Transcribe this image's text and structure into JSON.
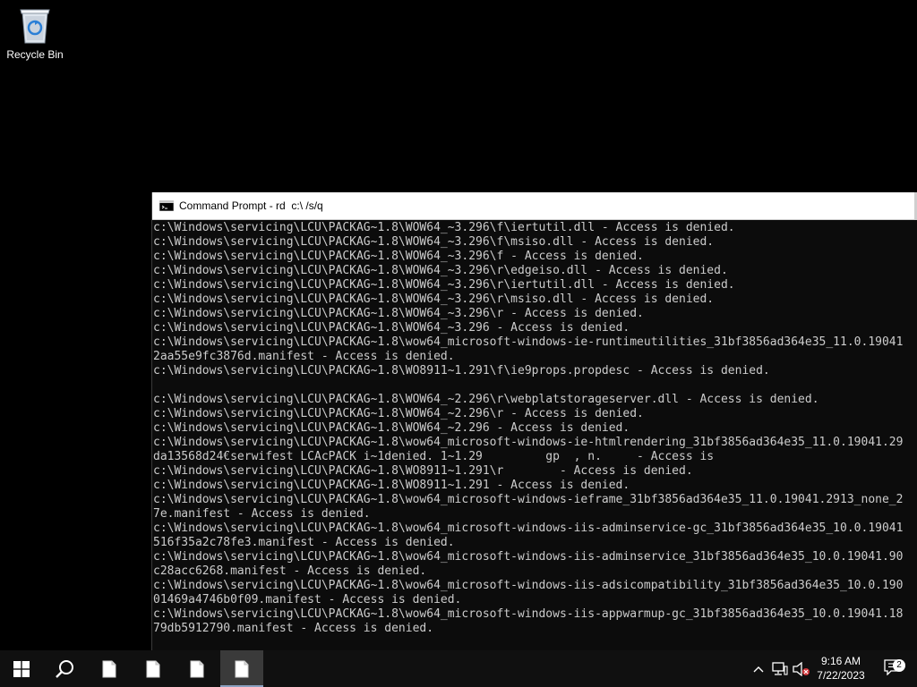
{
  "desktop": {
    "recycle_bin_label": "Recycle Bin"
  },
  "window": {
    "title": "Command Prompt - rd  c:\\ /s/q",
    "lines": [
      "c:\\Windows\\servicing\\LCU\\PACKAG~1.8\\WOW64_~3.296\\f\\iertutil.dll - Access is denied.",
      "c:\\Windows\\servicing\\LCU\\PACKAG~1.8\\WOW64_~3.296\\f\\msiso.dll - Access is denied.",
      "c:\\Windows\\servicing\\LCU\\PACKAG~1.8\\WOW64_~3.296\\f - Access is denied.",
      "c:\\Windows\\servicing\\LCU\\PACKAG~1.8\\WOW64_~3.296\\r\\edgeiso.dll - Access is denied.",
      "c:\\Windows\\servicing\\LCU\\PACKAG~1.8\\WOW64_~3.296\\r\\iertutil.dll - Access is denied.",
      "c:\\Windows\\servicing\\LCU\\PACKAG~1.8\\WOW64_~3.296\\r\\msiso.dll - Access is denied.",
      "c:\\Windows\\servicing\\LCU\\PACKAG~1.8\\WOW64_~3.296\\r - Access is denied.",
      "c:\\Windows\\servicing\\LCU\\PACKAG~1.8\\WOW64_~3.296 - Access is denied.",
      "c:\\Windows\\servicing\\LCU\\PACKAG~1.8\\wow64_microsoft-windows-ie-runtimeutilities_31bf3856ad364e35_11.0.19041",
      "2aa55e9fc3876d.manifest - Access is denied.",
      "c:\\Windows\\servicing\\LCU\\PACKAG~1.8\\WO8911~1.291\\f\\ie9props.propdesc - Access is denied.",
      "",
      "c:\\Windows\\servicing\\LCU\\PACKAG~1.8\\WOW64_~2.296\\r\\webplatstorageserver.dll - Access is denied.",
      "c:\\Windows\\servicing\\LCU\\PACKAG~1.8\\WOW64_~2.296\\r - Access is denied.",
      "c:\\Windows\\servicing\\LCU\\PACKAG~1.8\\WOW64_~2.296 - Access is denied.",
      "c:\\Windows\\servicing\\LCU\\PACKAG~1.8\\wow64_microsoft-windows-ie-htmlrendering_31bf3856ad364e35_11.0.19041.29",
      "da13568d24€serwifest LCAcPACK i~1denied. 1~1.29         gp  , n.     - Access is",
      "c:\\Windows\\servicing\\LCU\\PACKAG~1.8\\WO8911~1.291\\r        - Access is denied.",
      "c:\\Windows\\servicing\\LCU\\PACKAG~1.8\\WO8911~1.291 - Access is denied.",
      "c:\\Windows\\servicing\\LCU\\PACKAG~1.8\\wow64_microsoft-windows-ieframe_31bf3856ad364e35_11.0.19041.2913_none_2",
      "7e.manifest - Access is denied.",
      "c:\\Windows\\servicing\\LCU\\PACKAG~1.8\\wow64_microsoft-windows-iis-adminservice-gc_31bf3856ad364e35_10.0.19041",
      "516f35a2c78fe3.manifest - Access is denied.",
      "c:\\Windows\\servicing\\LCU\\PACKAG~1.8\\wow64_microsoft-windows-iis-adminservice_31bf3856ad364e35_10.0.19041.90",
      "c28acc6268.manifest - Access is denied.",
      "c:\\Windows\\servicing\\LCU\\PACKAG~1.8\\wow64_microsoft-windows-iis-adsicompatibility_31bf3856ad364e35_10.0.190",
      "01469a4746b0f09.manifest - Access is denied.",
      "c:\\Windows\\servicing\\LCU\\PACKAG~1.8\\wow64_microsoft-windows-iis-appwarmup-gc_31bf3856ad364e35_10.0.19041.18",
      "79db5912790.manifest - Access is denied."
    ]
  },
  "taskbar": {
    "start_icon": "windows-logo-icon",
    "search_icon": "search-icon",
    "apps": [
      {
        "icon": "document-icon",
        "active": false
      },
      {
        "icon": "document-icon",
        "active": false
      },
      {
        "icon": "document-icon",
        "active": false
      },
      {
        "icon": "document-icon",
        "active": true
      }
    ],
    "tray": {
      "chevron_icon": "chevron-up-icon",
      "network_icon": "network-icon",
      "volume_icon": "volume-muted-icon",
      "time": "9:16 AM",
      "date": "7/22/2023",
      "notification_count": "2"
    }
  },
  "colors": {
    "console_text": "#cccccc",
    "console_bg": "#0c0c0c",
    "taskbar_bg": "#101010"
  }
}
